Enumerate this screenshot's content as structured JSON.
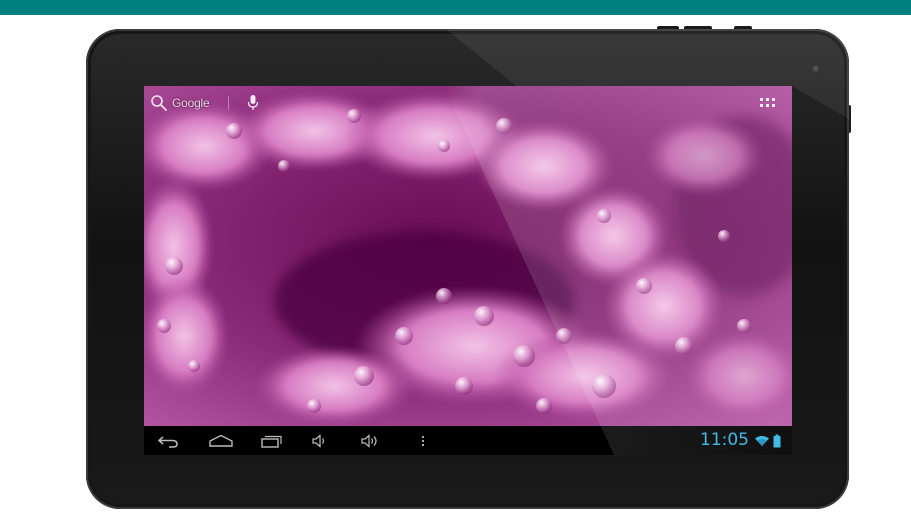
{
  "colors": {
    "top_bar": "#007f7f",
    "bezel": "#151515",
    "nav_bar": "#000000",
    "clock": "#33b5e5",
    "battery": "#33b5e5",
    "wallpaper_base": "#7a1e68",
    "wallpaper_highlight": "#e9a6d8"
  },
  "home_screen": {
    "search_widget": {
      "label": "Google",
      "search_icon": "search-icon",
      "voice_icon": "microphone-icon"
    },
    "apps_button_icon": "apps-grid-icon",
    "wallpaper": "pink-coral-water-droplets"
  },
  "navigation_bar": {
    "buttons": [
      {
        "name": "back",
        "icon": "back-icon"
      },
      {
        "name": "home",
        "icon": "home-icon"
      },
      {
        "name": "recent-apps",
        "icon": "recent-apps-icon"
      },
      {
        "name": "volume-down",
        "icon": "volume-down-icon"
      },
      {
        "name": "volume-up",
        "icon": "volume-up-icon"
      },
      {
        "name": "menu",
        "icon": "overflow-menu-icon"
      }
    ]
  },
  "status_bar": {
    "time": "11:05",
    "wifi_icon": "wifi-icon",
    "battery_icon": "battery-icon"
  }
}
